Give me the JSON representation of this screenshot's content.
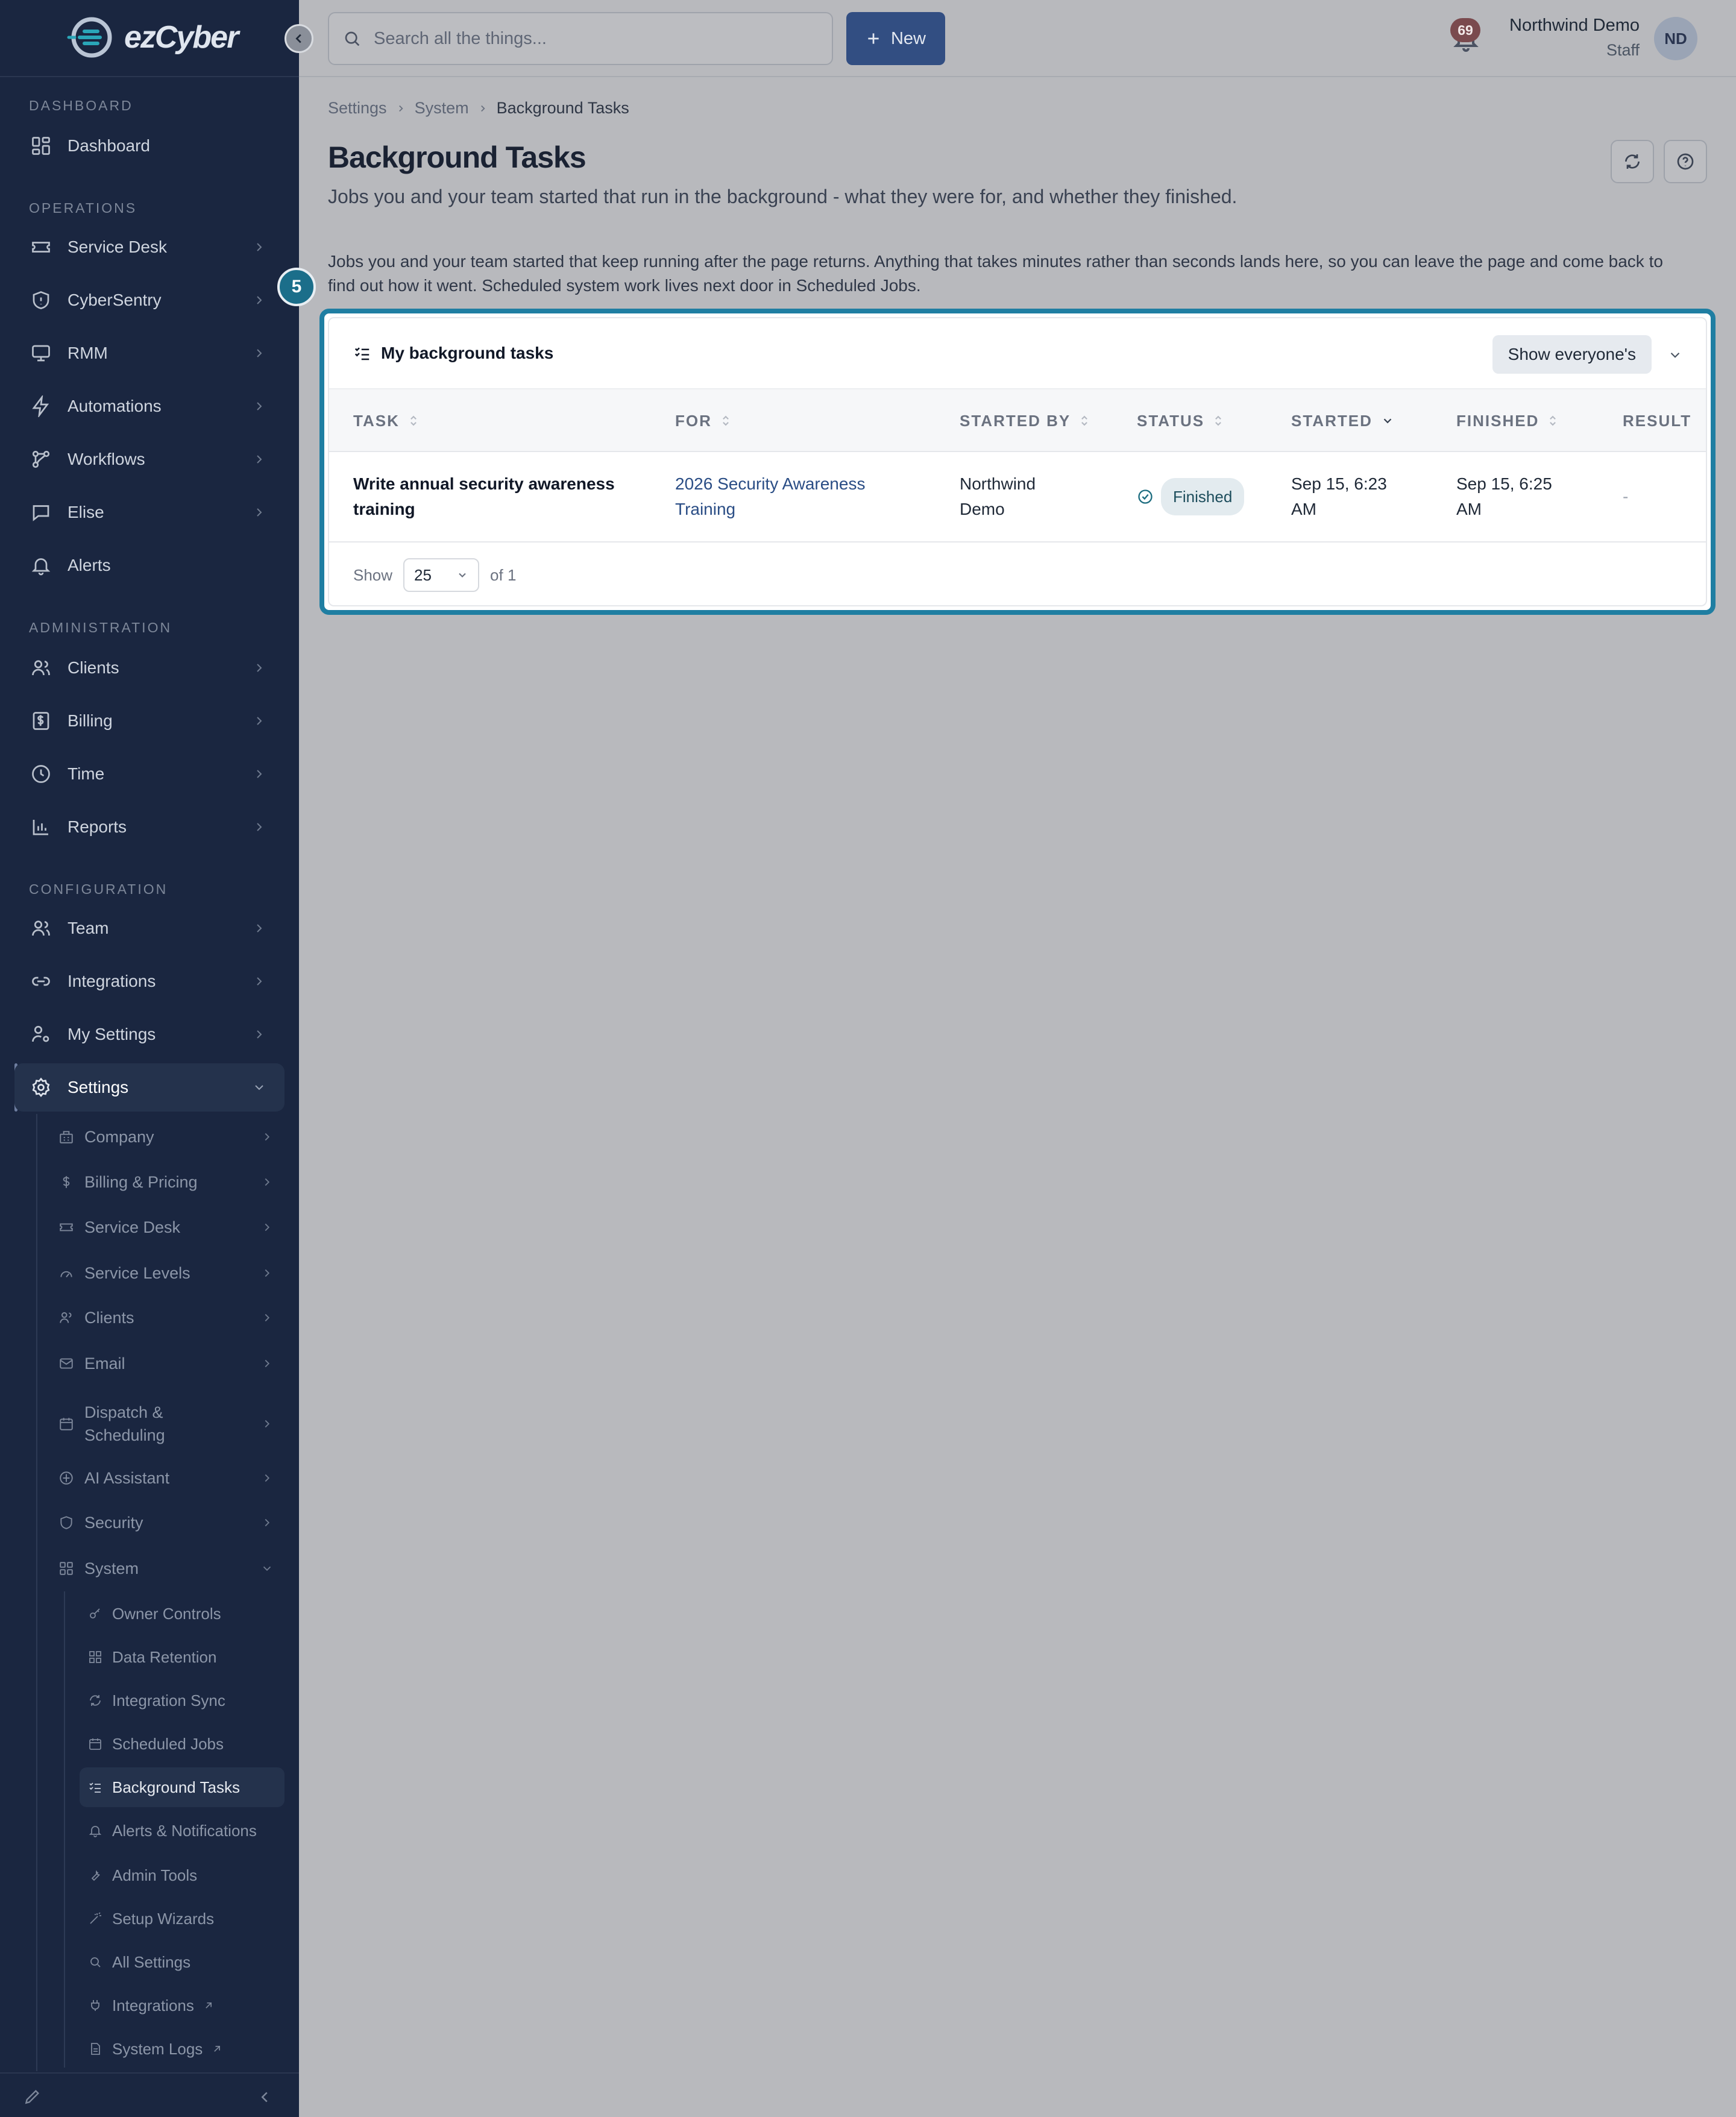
{
  "app": {
    "logo_text": "ezCyber"
  },
  "search": {
    "placeholder": "Search all the things..."
  },
  "topbar": {
    "new_label": "New",
    "notifications_count": "69",
    "user_name": "Northwind Demo",
    "user_role": "Staff",
    "user_initials": "ND"
  },
  "sidebar": {
    "sections": {
      "dashboard": "DASHBOARD",
      "operations": "OPERATIONS",
      "administration": "ADMINISTRATION",
      "configuration": "CONFIGURATION"
    },
    "items": {
      "dashboard": "Dashboard",
      "service_desk": "Service Desk",
      "cybersentry": "CyberSentry",
      "rmm": "RMM",
      "automations": "Automations",
      "workflows": "Workflows",
      "elise": "Elise",
      "alerts": "Alerts",
      "clients": "Clients",
      "billing": "Billing",
      "time": "Time",
      "reports": "Reports",
      "team": "Team",
      "integrations": "Integrations",
      "my_settings": "My Settings",
      "settings": "Settings"
    },
    "settings_sub": {
      "company": "Company",
      "billing_pricing": "Billing & Pricing",
      "service_desk": "Service Desk",
      "service_levels": "Service Levels",
      "clients": "Clients",
      "email": "Email",
      "dispatch_line1": "Dispatch &",
      "dispatch_line2": "Scheduling",
      "ai_assistant": "AI Assistant",
      "security": "Security",
      "system": "System"
    },
    "system_sub": {
      "owner_controls": "Owner Controls",
      "data_retention": "Data Retention",
      "integration_sync": "Integration Sync",
      "scheduled_jobs": "Scheduled Jobs",
      "background_tasks": "Background Tasks",
      "alerts_notifications": "Alerts & Notifications",
      "admin_tools": "Admin Tools",
      "setup_wizards": "Setup Wizards",
      "all_settings": "All Settings",
      "integrations": "Integrations",
      "system_logs": "System Logs"
    }
  },
  "breadcrumb": [
    "Settings",
    "System",
    "Background Tasks"
  ],
  "page": {
    "title": "Background Tasks",
    "subtitle": "Jobs you and your team started that run in the background - what they were for, and whether they finished.",
    "intro": "Jobs you and your team started that keep running after the page returns. Anything that takes minutes rather than seconds lands here, so you can leave the page and come back to find out how it went. Scheduled system work lives next door in Scheduled Jobs."
  },
  "tour": {
    "step": "5"
  },
  "card": {
    "title": "My background tasks",
    "toggle_label": "Show everyone's",
    "columns": [
      "TASK",
      "FOR",
      "STARTED BY",
      "STATUS",
      "STARTED",
      "FINISHED",
      "RESULT"
    ],
    "rows": [
      {
        "task_line1": "Write annual security awareness",
        "task_line2": "training",
        "for_line1": "2026 Security Awareness",
        "for_line2": "Training",
        "started_by_line1": "Northwind",
        "started_by_line2": "Demo",
        "status": "Finished",
        "started_line1": "Sep 15, 6:23",
        "started_line2": "AM",
        "finished_line1": "Sep 15, 6:25",
        "finished_line2": "AM",
        "result": "-"
      }
    ],
    "footer": {
      "show_label": "Show",
      "page_size": "25",
      "of_label": "of 1"
    }
  },
  "colors": {
    "sidebar_bg": "#1a2640",
    "primary_button": "#324e82",
    "highlight": "#1f7ea2"
  }
}
